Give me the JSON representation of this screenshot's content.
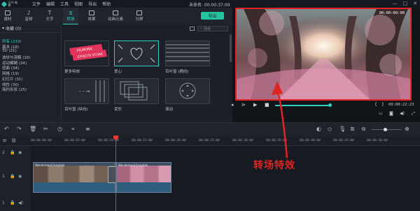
{
  "app": {
    "logo_text": "万兴\n喵影",
    "menu": [
      "文件",
      "编辑",
      "工具",
      "视图",
      "导出",
      "帮助"
    ],
    "project_title": "未命名: 00:00:37:09",
    "window_controls": [
      "—",
      "□",
      "✕"
    ]
  },
  "tabs": [
    {
      "label": "媒材",
      "icon": "folder-icon"
    },
    {
      "label": "音频",
      "icon": "music-note-icon"
    },
    {
      "label": "文字",
      "icon": "text-icon"
    },
    {
      "label": "转场",
      "icon": "transition-icon",
      "active": true
    },
    {
      "label": "效果",
      "icon": "effects-icon"
    },
    {
      "label": "动画元素",
      "icon": "image-icon"
    },
    {
      "label": "分屏",
      "icon": "split-screen-icon"
    }
  ],
  "export_label": "导出",
  "categories": {
    "favorites": "收藏 (0)",
    "items": [
      {
        "label": "所有 (233)",
        "selected": true
      },
      {
        "label": "基本 (18)"
      },
      {
        "label": "3D (21)"
      },
      {
        "label": "波纹与溶解 (16)"
      },
      {
        "label": "运动模糊 (34)"
      },
      {
        "label": "扭曲 (34)"
      },
      {
        "label": "网格 (19)"
      },
      {
        "label": "幻灯片 (31)"
      },
      {
        "label": "线性 (30)"
      },
      {
        "label": "简约形状 (25)"
      }
    ]
  },
  "library": {
    "search_placeholder": "搜索",
    "thumbnails": [
      {
        "label": "更多特效",
        "banner1": "FILMORA",
        "banner2": "EFFECTS STORE"
      },
      {
        "label": "爱心"
      },
      {
        "label": "百叶窗 (横向)"
      },
      {
        "label": "百叶窗 (纵向)"
      },
      {
        "label": "变形"
      },
      {
        "label": "滚动"
      }
    ]
  },
  "preview": {
    "time_top": "00:00:00:00",
    "time_bottom": "00:00:22:23"
  },
  "timeline": {
    "ruler_ticks": [
      "00:00:00:00",
      "00:00:05:00",
      "00:00:10:00",
      "00:00:15:00",
      "00:00:20:00",
      "00:00:25:00",
      "00:00:30:00",
      "00:00:35:00",
      "00:00:40:00",
      "00:00:45:00",
      "00:00:50:00"
    ],
    "track_labels": [
      "2",
      "1",
      "1"
    ],
    "clip1_label": "Wonderland Fairytale",
    "clip2_label": "Wonderland Fairytale"
  },
  "annotation": {
    "text": "转场特效",
    "color": "#e02424"
  }
}
